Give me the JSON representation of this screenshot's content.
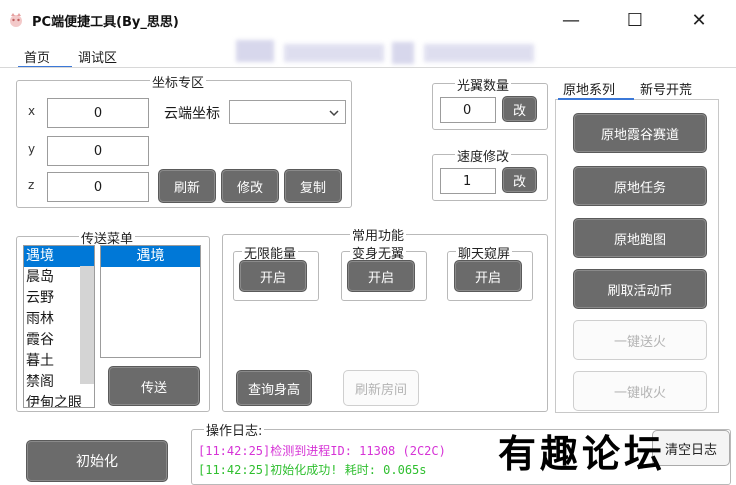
{
  "window": {
    "title": "PC端便捷工具(By_思思)",
    "minimize_glyph": "—",
    "maximize_glyph": "☐",
    "close_glyph": "✕"
  },
  "tabs": [
    {
      "label": "首页",
      "active": true
    },
    {
      "label": "调试区",
      "active": false
    }
  ],
  "coords": {
    "legend": "坐标专区",
    "x_label": "x",
    "y_label": "y",
    "z_label": "z",
    "x_value": "0",
    "y_value": "0",
    "z_value": "0",
    "cloud_label": "云端坐标",
    "cloud_select_value": "",
    "refresh_label": "刷新",
    "modify_label": "修改",
    "copy_label": "复制"
  },
  "light_wing": {
    "legend": "光翼数量",
    "value": "0",
    "button": "改"
  },
  "speed": {
    "legend": "速度修改",
    "value": "1",
    "button": "改"
  },
  "teleport": {
    "legend": "传送菜单",
    "locations": [
      "遇境",
      "晨岛",
      "云野",
      "雨林",
      "霞谷",
      "暮土",
      "禁阁",
      "伊甸之眼"
    ],
    "selected_index": 0,
    "sub_items": [
      "遇境"
    ],
    "send_label": "传送"
  },
  "common": {
    "legend": "常用功能",
    "groups": [
      {
        "legend": "无限能量",
        "button": "开启"
      },
      {
        "legend": "变身无翼",
        "button": "开启"
      },
      {
        "legend": "聊天窥屏",
        "button": "开启"
      }
    ],
    "query_height_label": "查询身高",
    "refresh_room_label": "刷新房间"
  },
  "right_tabs": [
    {
      "label": "原地系列",
      "active": true
    },
    {
      "label": "新号开荒",
      "active": false
    }
  ],
  "right_buttons": [
    {
      "label": "原地霞谷赛道",
      "enabled": true
    },
    {
      "label": "原地任务",
      "enabled": true
    },
    {
      "label": "原地跑图",
      "enabled": true
    },
    {
      "label": "刷取活动币",
      "enabled": true
    },
    {
      "label": "一键送火",
      "enabled": false
    },
    {
      "label": "一键收火",
      "enabled": false
    }
  ],
  "init_label": "初始化",
  "log": {
    "legend": "操作日志:",
    "lines": [
      {
        "text": "[11:42:25]检测到进程ID: 11308 (2C2C)",
        "color": "#d633d6"
      },
      {
        "text": "[11:42:25]初始化成功! 耗时: 0.065s",
        "color": "#2fbf2f"
      }
    ],
    "clear_label": "清空日志"
  },
  "watermark": "有趣论坛",
  "colors": {
    "button_dark": "#6b6b6b",
    "selection": "#0078d7",
    "tab_underline": "#3b78d8"
  }
}
